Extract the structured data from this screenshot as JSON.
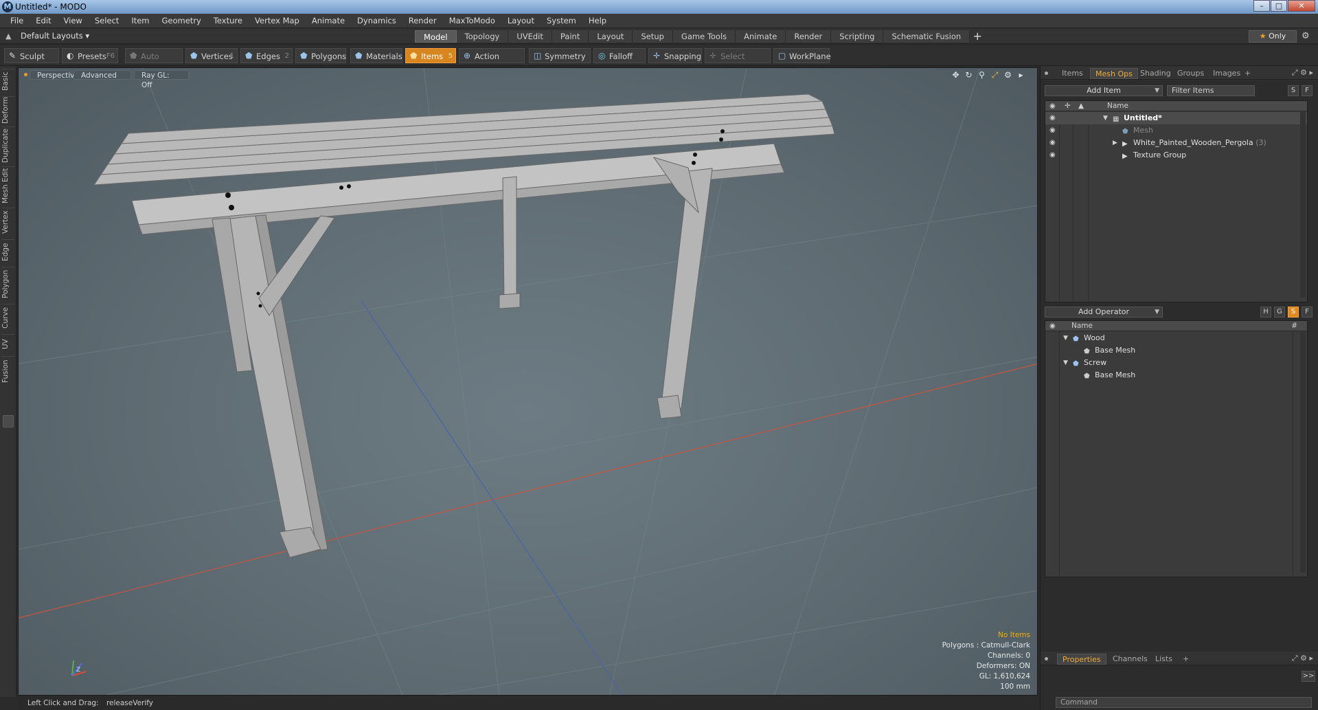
{
  "window": {
    "title": "Untitled* - MODO",
    "app_icon_glyph": "M",
    "buttons": {
      "minimize": "–",
      "maximize": "□",
      "close": "✕"
    }
  },
  "menu": [
    "File",
    "Edit",
    "View",
    "Select",
    "Item",
    "Geometry",
    "Texture",
    "Vertex Map",
    "Animate",
    "Dynamics",
    "Render",
    "MaxToModo",
    "Layout",
    "System",
    "Help"
  ],
  "layout_selector": {
    "label": "Default Layouts ▾"
  },
  "tabs": [
    {
      "label": "Model",
      "active": true
    },
    {
      "label": "Topology"
    },
    {
      "label": "UVEdit"
    },
    {
      "label": "Paint"
    },
    {
      "label": "Layout"
    },
    {
      "label": "Setup"
    },
    {
      "label": "Game Tools"
    },
    {
      "label": "Animate"
    },
    {
      "label": "Render"
    },
    {
      "label": "Scripting"
    },
    {
      "label": "Schematic Fusion"
    }
  ],
  "tabs_add": "+",
  "only_button": {
    "star": "★",
    "label": "Only"
  },
  "toolbar": {
    "sculpt": "Sculpt",
    "presets": "Presets",
    "presets_key": "F6",
    "auto_select": "Auto Select",
    "vertices": "Vertices",
    "vertices_key": "1",
    "edges": "Edges",
    "edges_key": "2",
    "polygons": "Polygons",
    "materials": "Materials",
    "items": "Items",
    "items_key": "5",
    "action_center": "Action Center",
    "symmetry": "Symmetry",
    "falloff": "Falloff",
    "snapping": "Snapping",
    "select_through": "Select Through",
    "workplane": "WorkPlane"
  },
  "left_tabs": [
    "Basic",
    "Deform",
    "Duplicate",
    "Mesh Edit",
    "Vertex",
    "Edge",
    "Polygon",
    "Curve",
    "UV",
    "Fusion"
  ],
  "viewport": {
    "view": "Perspective",
    "mode": "Advanced",
    "raygl": "Ray GL: Off",
    "info": {
      "no_items": "No Items",
      "polygons": "Polygons : Catmull-Clark",
      "channels": "Channels: 0",
      "deformers": "Deformers: ON",
      "gl": "GL: 1,610,624",
      "scale": "100 mm"
    },
    "gizmo_label": "Z"
  },
  "status": {
    "hint": "Left Click and Drag:",
    "action": "releaseVerify"
  },
  "item_panel": {
    "tabs": [
      {
        "label": "Items"
      },
      {
        "label": "Mesh Ops",
        "active": true
      },
      {
        "label": "Shading"
      },
      {
        "label": "Groups"
      },
      {
        "label": "Images"
      },
      {
        "label": "+"
      }
    ],
    "add_item": "Add Item",
    "filter_placeholder": "Filter Items",
    "s_btn": "S",
    "f_btn": "F",
    "column_name": "Name",
    "rows": [
      {
        "name": "Untitled*"
      },
      {
        "name": "Mesh"
      },
      {
        "name": "White_Painted_Wooden_Pergola",
        "count": "(3)"
      },
      {
        "name": "Texture Group"
      }
    ]
  },
  "operator_panel": {
    "add_operator": "Add Operator",
    "h_btn": "H",
    "g_btn": "G",
    "s_btn": "S",
    "f_btn": "F",
    "column_name": "Name",
    "column_hash": "#",
    "rows": [
      {
        "name": "Wood"
      },
      {
        "name": "Base Mesh"
      },
      {
        "name": "Screw"
      },
      {
        "name": "Base Mesh"
      }
    ]
  },
  "properties_panel": {
    "tabs": [
      {
        "label": "Properties",
        "active": true
      },
      {
        "label": "Channels"
      },
      {
        "label": "Lists"
      },
      {
        "label": "+"
      }
    ],
    "expand": ">>",
    "command_placeholder": "Command"
  }
}
